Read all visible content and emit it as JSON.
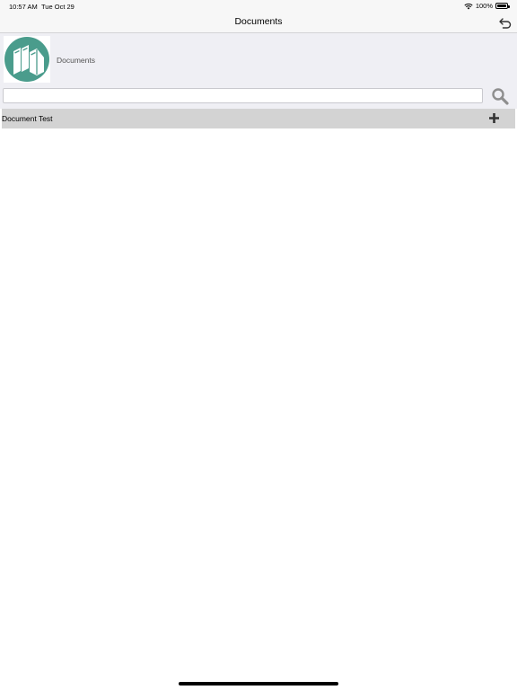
{
  "status": {
    "time": "10:57 AM",
    "date": "Tue Oct 29",
    "battery": "100%",
    "battery_level": 1.0
  },
  "nav": {
    "title": "Documents",
    "back_icon": "undo-arrow-icon"
  },
  "header": {
    "label": "Documents",
    "logo_icon": "books-logo-icon",
    "accent_color": "#4a9c8c"
  },
  "search": {
    "value": "",
    "placeholder": "",
    "icon": "search-icon"
  },
  "list": {
    "items": [
      {
        "label": "Document Test",
        "action_icon": "plus-icon"
      }
    ]
  }
}
